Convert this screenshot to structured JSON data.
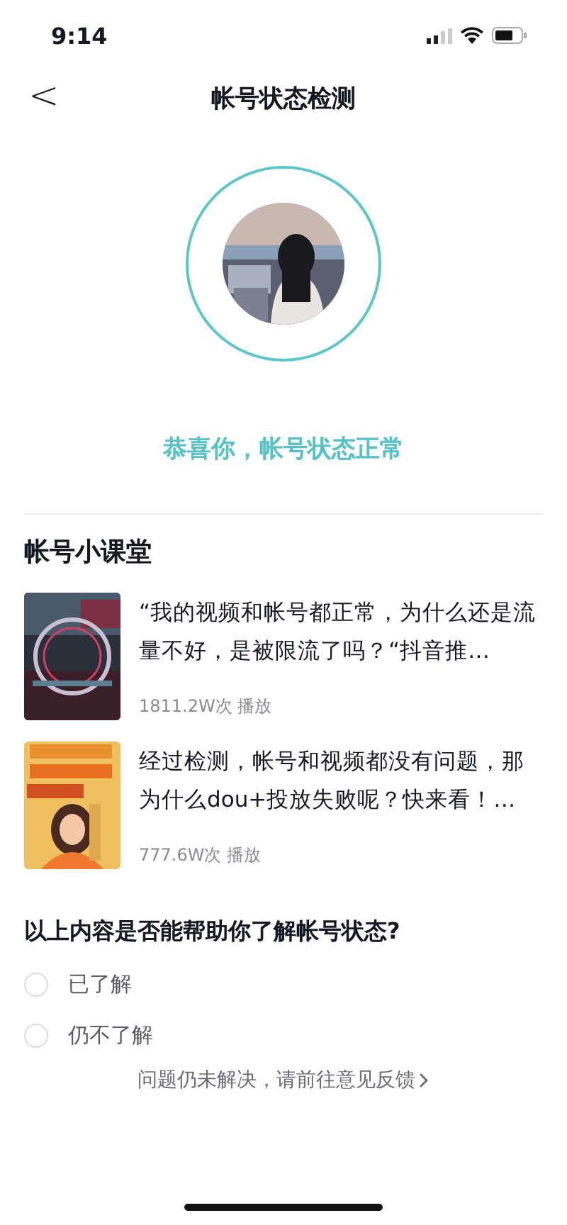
{
  "status_bar": {
    "time": "9:14"
  },
  "header": {
    "back": "<",
    "title": "帐号状态检测"
  },
  "account_status": {
    "message": "恭喜你，帐号状态正常"
  },
  "course": {
    "title": "帐号小课堂",
    "items": [
      {
        "title": "“我的视频和帐号都正常，为什么还是流量不好，是被限流了吗？“抖音推…",
        "views": "1811.2W次 播放"
      },
      {
        "title": "经过检测，帐号和视频都没有问题，那为什么dou+投放失败呢？快来看！…",
        "views": "777.6W次 播放"
      }
    ]
  },
  "survey": {
    "question": "以上内容是否能帮助你了解帐号状态?",
    "options": [
      {
        "label": "已了解",
        "selected": false
      },
      {
        "label": "仍不了解",
        "selected": false
      }
    ]
  },
  "feedback_link": "问题仍未解决，请前往意见反馈"
}
